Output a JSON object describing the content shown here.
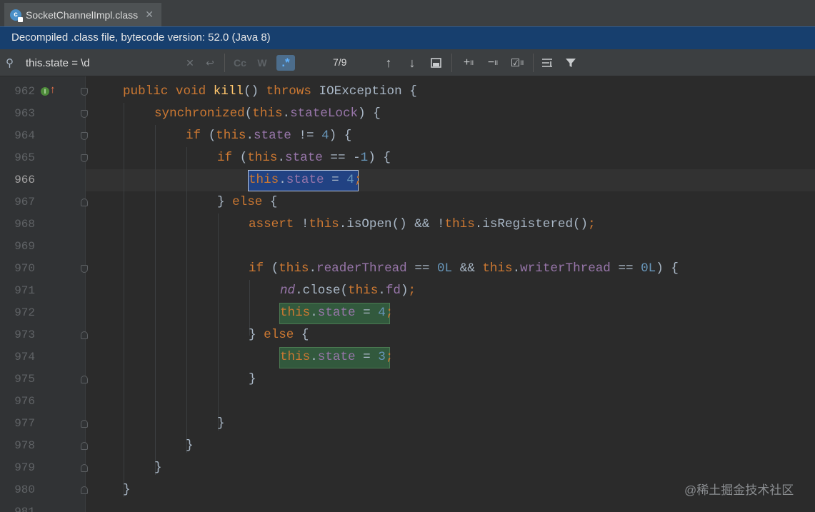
{
  "tab": {
    "title": "SocketChannelImpl.class",
    "icon_letter": "c"
  },
  "banner": {
    "text": "Decompiled .class file, bytecode version: 52.0 (Java 8)"
  },
  "search": {
    "query": "this.state = \\d",
    "match_count": "7/9",
    "case_label": "Cc",
    "word_label": "W",
    "regex_label": ".*"
  },
  "editor": {
    "line_numbers": [
      "962",
      "963",
      "964",
      "965",
      "966",
      "967",
      "968",
      "969",
      "970",
      "971",
      "972",
      "973",
      "974",
      "975",
      "976",
      "977",
      "978",
      "979",
      "980",
      "981"
    ],
    "current_line": "966"
  },
  "watermark": "@稀土掘金技术社区",
  "colors": {
    "keyword": "#cc7832",
    "method": "#ffc66d",
    "field": "#9876aa",
    "number": "#6897bb",
    "text": "#a9b7c6",
    "banner": "#173f6e"
  }
}
